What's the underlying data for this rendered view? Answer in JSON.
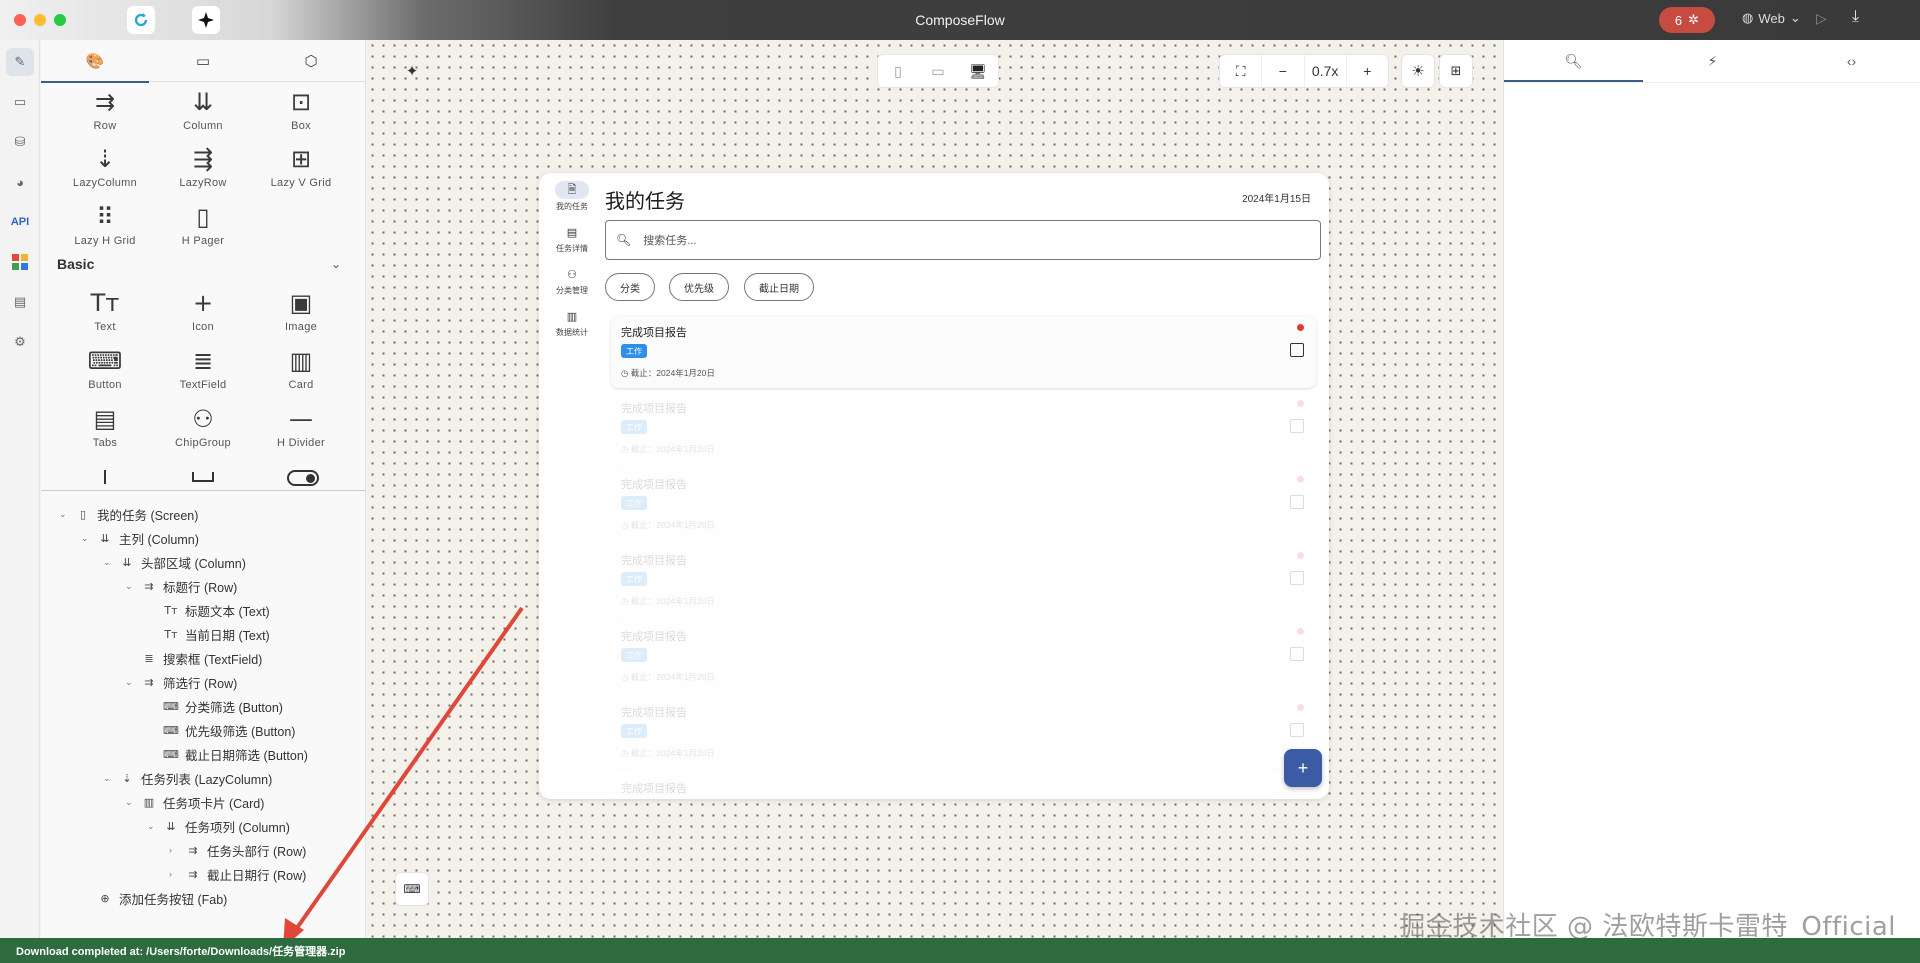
{
  "window": {
    "title": "ComposeFlow",
    "bug_count": "6",
    "platform": "Web",
    "run_icon": "play-icon",
    "download_icon": "download-icon"
  },
  "rail": [
    "editor-icon",
    "layout-icon",
    "database-icon",
    "theme-icon",
    "API",
    "apps-icon",
    "assets-icon",
    "settings-icon"
  ],
  "palette": {
    "tabs": [
      "palette-icon",
      "screen-icon",
      "module-icon"
    ],
    "layout_components": [
      {
        "label": "Row",
        "icon": "⇉"
      },
      {
        "label": "Column",
        "icon": "⇊"
      },
      {
        "label": "Box",
        "icon": "⊡"
      },
      {
        "label": "LazyColumn",
        "icon": "⇣"
      },
      {
        "label": "LazyRow",
        "icon": "⇶"
      },
      {
        "label": "Lazy V Grid",
        "icon": "⊞"
      },
      {
        "label": "Lazy H Grid",
        "icon": "⠿"
      },
      {
        "label": "H Pager",
        "icon": "▯"
      }
    ],
    "basic_section": "Basic",
    "basic_components": [
      {
        "label": "Text",
        "icon": "Tт"
      },
      {
        "label": "Icon",
        "icon": "+"
      },
      {
        "label": "Image",
        "icon": "▣"
      },
      {
        "label": "Button",
        "icon": "⌨"
      },
      {
        "label": "TextField",
        "icon": "≣"
      },
      {
        "label": "Card",
        "icon": "▥"
      },
      {
        "label": "Tabs",
        "icon": "▤"
      },
      {
        "label": "ChipGroup",
        "icon": "⚇"
      },
      {
        "label": "H Divider",
        "icon": "—"
      }
    ]
  },
  "tree": [
    {
      "label": "我的任务 (Screen)",
      "depth": 0,
      "icon": "▯",
      "toggle": "⌄"
    },
    {
      "label": "主列 (Column)",
      "depth": 1,
      "icon": "⇊",
      "toggle": "⌄"
    },
    {
      "label": "头部区域 (Column)",
      "depth": 2,
      "icon": "⇊",
      "toggle": "⌄"
    },
    {
      "label": "标题行 (Row)",
      "depth": 3,
      "icon": "⇉",
      "toggle": "⌄"
    },
    {
      "label": "标题文本 (Text)",
      "depth": 4,
      "icon": "Tт",
      "toggle": ""
    },
    {
      "label": "当前日期 (Text)",
      "depth": 4,
      "icon": "Tт",
      "toggle": ""
    },
    {
      "label": "搜索框 (TextField)",
      "depth": 3,
      "icon": "≣",
      "toggle": ""
    },
    {
      "label": "筛选行 (Row)",
      "depth": 3,
      "icon": "⇉",
      "toggle": "⌄"
    },
    {
      "label": "分类筛选 (Button)",
      "depth": 4,
      "icon": "⌨",
      "toggle": ""
    },
    {
      "label": "优先级筛选 (Button)",
      "depth": 4,
      "icon": "⌨",
      "toggle": ""
    },
    {
      "label": "截止日期筛选 (Button)",
      "depth": 4,
      "icon": "⌨",
      "toggle": ""
    },
    {
      "label": "任务列表 (LazyColumn)",
      "depth": 2,
      "icon": "⇣",
      "toggle": "⌄"
    },
    {
      "label": "任务项卡片 (Card)",
      "depth": 3,
      "icon": "▥",
      "toggle": "⌄"
    },
    {
      "label": "任务项列 (Column)",
      "depth": 4,
      "icon": "⇊",
      "toggle": "⌄"
    },
    {
      "label": "任务头部行 (Row)",
      "depth": 5,
      "icon": "⇉",
      "toggle": "›"
    },
    {
      "label": "截止日期行 (Row)",
      "depth": 5,
      "icon": "⇉",
      "toggle": "›"
    },
    {
      "label": "添加任务按钮 (Fab)",
      "depth": 1,
      "icon": "⊕",
      "toggle": ""
    }
  ],
  "canvas": {
    "zoom": "0.7x",
    "zoom_minus": "−",
    "zoom_plus": "+",
    "device_modes": [
      "phone",
      "tablet",
      "desktop"
    ]
  },
  "app": {
    "nav": [
      {
        "label": "我的任务",
        "icon": "🗎"
      },
      {
        "label": "任务详情",
        "icon": "▤"
      },
      {
        "label": "分类管理",
        "icon": "⚇"
      },
      {
        "label": "数据统计",
        "icon": "▥"
      }
    ],
    "title": "我的任务",
    "date": "2024年1月15日",
    "search_placeholder": "搜索任务...",
    "chips": [
      "分类",
      "优先级",
      "截止日期"
    ],
    "task": {
      "title": "完成项目报告",
      "tag": "工作",
      "due": "◷ 截止：2024年1月20日"
    },
    "fab": "+"
  },
  "right_panel": {
    "tabs": [
      "inspector-icon",
      "actions-icon",
      "code-icon"
    ]
  },
  "status": "Download completed at: /Users/forte/Downloads/任务管理器.zip",
  "watermark": "掘金技术社区 @ 法欧特斯卡雷特_Official",
  "colors": {
    "status_bar": "#2e6b3e",
    "accent": "#3b5ba5",
    "tag": "#2f8ee8",
    "priority_dot": "#e53935"
  }
}
